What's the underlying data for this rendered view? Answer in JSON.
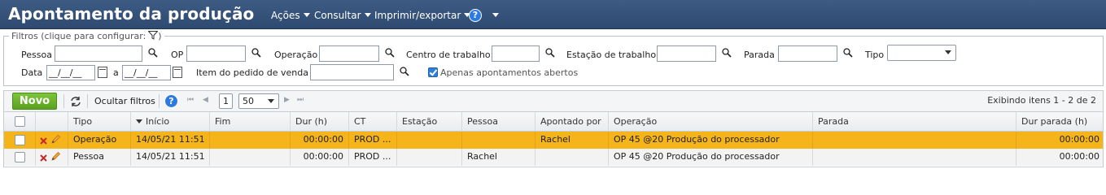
{
  "header": {
    "title": "Apontamento da produção",
    "menus": [
      {
        "label": "Ações"
      },
      {
        "label": "Consultar"
      },
      {
        "label": "Imprimir/exportar"
      }
    ],
    "help_label": "?"
  },
  "filters": {
    "legend": "Filtros (clique para configurar:",
    "legend_close": ")",
    "pessoa_label": "Pessoa",
    "op_label": "OP",
    "operacao_label": "Operação",
    "centro_label": "Centro de trabalho",
    "estacao_label": "Estação de trabalho",
    "parada_label": "Parada",
    "tipo_label": "Tipo",
    "data_label": "Data",
    "data_from": "__/__/__",
    "data_sep": "a",
    "data_to": "__/__/__",
    "item_pedido_label": "Item do pedido de venda",
    "apenas_abertos_label": "Apenas apontamentos abertos",
    "apenas_abertos_checked": true
  },
  "toolbar": {
    "novo_label": "Novo",
    "ocultar_filtros_label": "Ocultar filtros",
    "help_label": "?",
    "first_label": "⏮",
    "prev_label": "◀",
    "page_value": "1",
    "page_size": "50",
    "next_label": "▶",
    "last_label": "⏭",
    "pager_info": "Exibindo itens 1 - 2 de 2"
  },
  "grid": {
    "columns": [
      "Tipo",
      "Início",
      "Fim",
      "Dur (h)",
      "CT",
      "Estação",
      "Pessoa",
      "Apontado por",
      "Operação",
      "Parada",
      "Dur parada (h)"
    ],
    "rows": [
      {
        "tipo": "Operação",
        "inicio": "14/05/21 11:51",
        "fim": "",
        "dur": "00:00:00",
        "ct": "PROD ...",
        "estacao": "",
        "pessoa": "",
        "apontado_por": "Rachel",
        "operacao": "OP 45 @20 Produção do processador",
        "parada": "",
        "dur_parada": "00:00:00",
        "selected": true
      },
      {
        "tipo": "Pessoa",
        "inicio": "14/05/21 11:51",
        "fim": "",
        "dur": "00:00:00",
        "ct": "PROD ...",
        "estacao": "",
        "pessoa": "Rachel",
        "apontado_por": "",
        "operacao": "OP 45 @20 Produção do processador",
        "parada": "",
        "dur_parada": "00:00:00",
        "selected": false
      }
    ]
  },
  "colors": {
    "header_bg": "#2e4a70",
    "selected_row": "#f4b41a",
    "novo_button": "#5aa11e",
    "help_blue": "#2d7be0"
  }
}
